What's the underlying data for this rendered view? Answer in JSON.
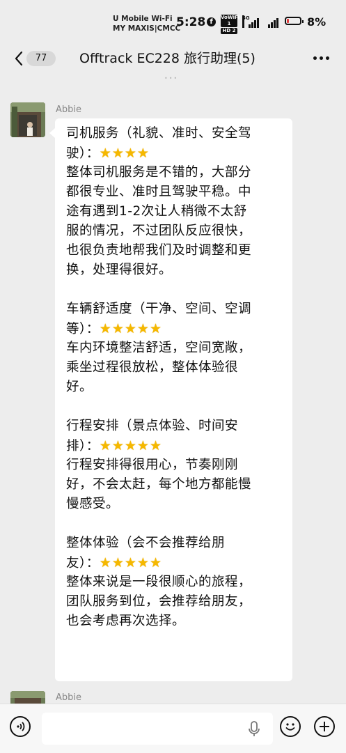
{
  "status_bar": {
    "carrier_line1": "U Mobile Wi-Fi",
    "carrier_line2": "MY MAXIS|CMCC",
    "time": "5:28",
    "volte1": "VoWiFi 1",
    "volte2": "HD 2",
    "network": "5G",
    "battery": "8%",
    "battery_level": 0.08,
    "icons": [
      "facebook-icon",
      "signal-icon",
      "battery-icon"
    ]
  },
  "header": {
    "unread_count": "77",
    "title": "Offtrack EC228 旅行助理(5)",
    "icons": [
      "back-arrow-icon",
      "more-icon"
    ]
  },
  "messages": [
    {
      "sender": "Abbie",
      "lines": [
        "司机服务（礼貌、准时、安全驾",
        "驶）：",
        "整体司机服务是不错的，大部分",
        "都很专业、准时且驾驶平稳。中",
        "途有遇到1-2次让人稍微不太舒",
        "服的情况，不过团队反应很快，",
        "也很负责地帮我们及时调整和更",
        "换，处理得很好。",
        "",
        "车辆舒适度（干净、空间、空调",
        "等）：",
        "车内环境整洁舒适，空间宽敞，",
        "乘坐过程很放松，整体体验很",
        "好。",
        "",
        "行程安排（景点体验、时间安",
        "排）：",
        "行程安排得很用心，节奏刚刚",
        "好，不会太赶，每个地方都能慢",
        "慢感受。",
        "",
        "整体体验（会不会推荐给朋",
        "友）：",
        "整体来说是一段很顺心的旅程，",
        "团队服务到位，会推荐给朋友，",
        "也会考虑再次选择。"
      ],
      "ratings": [
        {
          "after_line": 1,
          "stars": 4,
          "max": 5,
          "glyph": "⭐"
        },
        {
          "after_line": 10,
          "stars": 5,
          "max": 5,
          "glyph": "⭐"
        },
        {
          "after_line": 16,
          "stars": 5,
          "max": 5,
          "glyph": "⭐"
        },
        {
          "after_line": 22,
          "stars": 5,
          "max": 5,
          "glyph": "⭐"
        }
      ]
    },
    {
      "sender": "Abbie"
    }
  ],
  "input_bar": {
    "icons": [
      "voice-icon",
      "mic-icon",
      "emoji-icon",
      "plus-icon"
    ],
    "value": ""
  }
}
